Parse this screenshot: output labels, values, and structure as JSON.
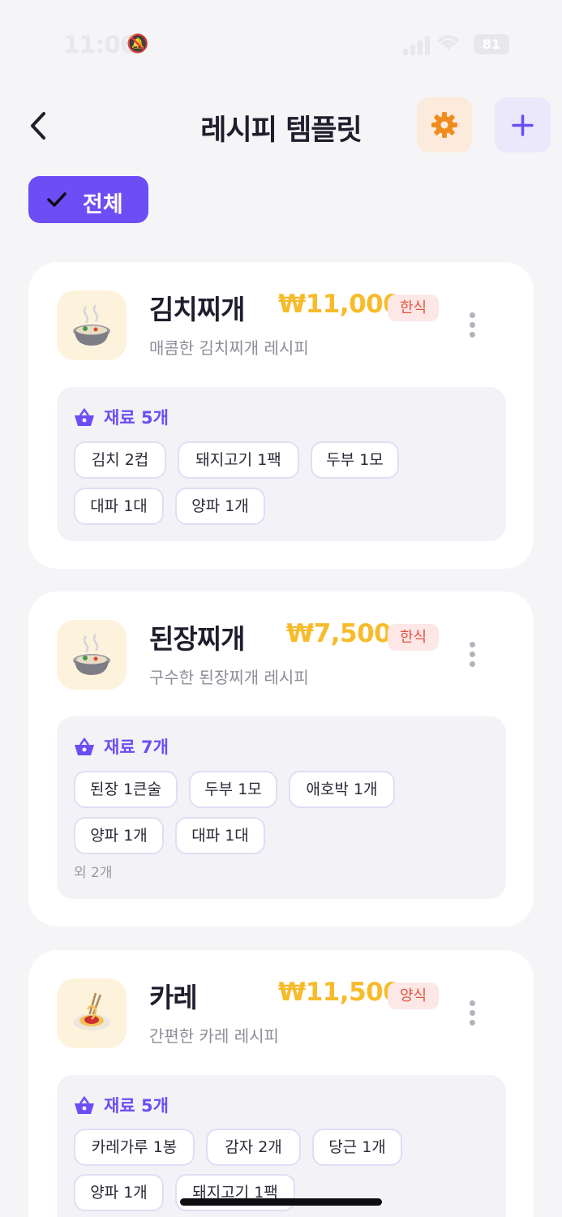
{
  "status_bar": {
    "time": "11:06",
    "battery": "81"
  },
  "header": {
    "title": "레시피 템플릿"
  },
  "filter": {
    "label": "전체"
  },
  "colors": {
    "accent": "#6c4df6",
    "price": "#f7bb2b",
    "badge_text": "#e5533d",
    "badge_bg": "#fde7e7",
    "gear": "#f08c1e"
  },
  "recipes": [
    {
      "name": "김치찌개",
      "price": "₩11,000",
      "category": "한식",
      "description": "매콤한 김치찌개 레시피",
      "icon": "stew-pot-icon",
      "ingredients_label": "재료 5개",
      "ingredients": [
        "김치 2컵",
        "돼지고기 1팩",
        "두부 1모",
        "대파 1대",
        "양파 1개"
      ],
      "more": ""
    },
    {
      "name": "된장찌개",
      "price": "₩7,500",
      "category": "한식",
      "description": "구수한 된장찌개 레시피",
      "icon": "stew-pot-icon",
      "ingredients_label": "재료 7개",
      "ingredients": [
        "된장 1큰술",
        "두부 1모",
        "애호박 1개",
        "양파 1개",
        "대파 1대"
      ],
      "more": "외 2개"
    },
    {
      "name": "카레",
      "price": "₩11,500",
      "category": "양식",
      "description": "간편한 카레 레시피",
      "icon": "spaghetti-icon",
      "ingredients_label": "재료 5개",
      "ingredients": [
        "카레가루 1봉",
        "감자 2개",
        "당근 1개",
        "양파 1개",
        "돼지고기 1팩"
      ],
      "more": ""
    }
  ]
}
